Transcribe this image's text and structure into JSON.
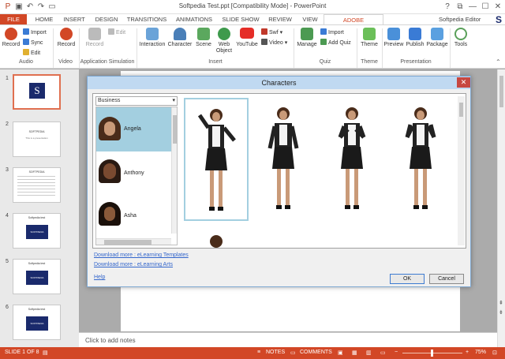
{
  "window": {
    "title": "Softpedia Test.ppt [Compatibility Mode] - PowerPoint",
    "user": "Softpedia Editor",
    "controls": [
      "?",
      "⧉",
      "—",
      "☐",
      "✕"
    ]
  },
  "tabs": [
    "FILE",
    "HOME",
    "INSERT",
    "DESIGN",
    "TRANSITIONS",
    "ANIMATIONS",
    "SLIDE SHOW",
    "REVIEW",
    "VIEW",
    "ADOBE PRESENTER"
  ],
  "ribbon": {
    "audio": {
      "record": "Record",
      "import": "Import",
      "sync": "Sync",
      "edit": "Edit",
      "label": "Audio"
    },
    "video": {
      "record": "Record",
      "label": "Video"
    },
    "appsim": {
      "record": "Record",
      "edit": "Edit",
      "label": "Application Simulation"
    },
    "insert": {
      "interaction": "Interaction",
      "character": "Character",
      "scene": "Scene",
      "web_object": "Web Object",
      "youtube": "YouTube",
      "swf": "Swf",
      "video": "Video",
      "label": "Insert"
    },
    "quiz": {
      "manage": "Manage",
      "import": "Import",
      "add_quiz": "Add Quiz",
      "label": "Quiz"
    },
    "theme": {
      "theme": "Theme",
      "label": "Theme"
    },
    "presentation": {
      "preview": "Preview",
      "publish": "Publish",
      "package": "Package",
      "label": "Presentation"
    },
    "tools": {
      "tools": "Tools"
    }
  },
  "thumbs": {
    "numbers": [
      "1",
      "2",
      "3",
      "4",
      "5",
      "6"
    ],
    "slide2_title": "SOFTPEDIA",
    "slide2_sub": "This is a presentation",
    "slide3_title": "SOFTPEDIA",
    "slide4_title": "Softpedia test",
    "slide4_box": "SOFTPEDIA",
    "slide5_title": "Softpedia test",
    "slide5_box": "SOFTPEDIA",
    "slide6_title": "Softpedia test",
    "slide6_box": "SOFTPEDIA",
    "logo_letter": "S"
  },
  "notes_placeholder": "Click to add notes",
  "dialog": {
    "title": "Characters",
    "category": "Business",
    "characters": [
      {
        "name": "Angela",
        "selected": true
      },
      {
        "name": "Anthony",
        "selected": false
      },
      {
        "name": "Asha",
        "selected": false
      }
    ],
    "links": [
      "Download more : eLearning Templates",
      "Download more : eLearning Arts",
      "Help"
    ],
    "ok": "OK",
    "cancel": "Cancel"
  },
  "statusbar": {
    "slide_info": "SLIDE 1 OF 8",
    "notes": "NOTES",
    "comments": "COMMENTS",
    "zoom": "75%"
  },
  "colors": {
    "accent": "#d24726",
    "selection": "#a3cfe0",
    "navy": "#1a2a6c"
  }
}
